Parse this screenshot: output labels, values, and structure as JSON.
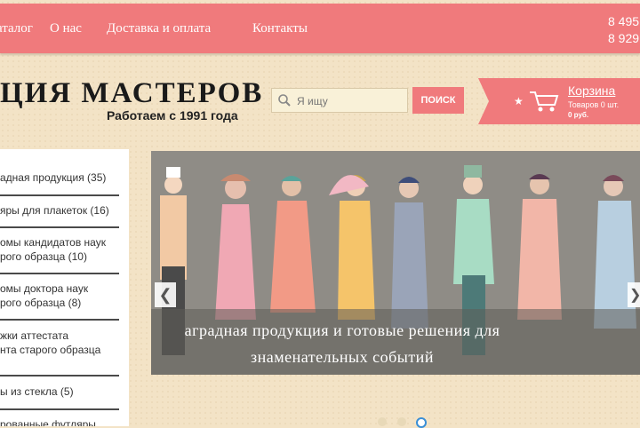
{
  "nav": {
    "items": [
      "аталог",
      "О нас",
      "Доставка и оплата",
      "Контакты"
    ],
    "phones": [
      "8 495",
      "8 929"
    ]
  },
  "logo": {
    "title": "ЦИЯ МАСТЕРОВ",
    "subtitle": "Работаем с 1991 года"
  },
  "search": {
    "placeholder": "Я ищу",
    "button": "ПОИСК"
  },
  "cart": {
    "title": "Корзина",
    "count": "Товаров 0 шт.",
    "sum": "0 руб."
  },
  "sidebar": {
    "categories": [
      [
        "адная продукция (35)"
      ],
      [
        "яры для плакеток (16)"
      ],
      [
        "омы кандидатов наук",
        "рого образца (10)"
      ],
      [
        "омы доктора наук",
        "рого образца (8)"
      ],
      [
        "жки аттестата",
        "нта старого образца"
      ],
      [
        "ы из стекла (5)"
      ],
      [
        "рованные футляры"
      ]
    ]
  },
  "slider": {
    "caption_line1": "аградная продукция и готовые решения для",
    "caption_line2": "знаменательных событий",
    "prev_icon": "chevron-left-icon",
    "next_icon": "chevron-right-icon"
  },
  "colors": {
    "accent": "#f07a7c",
    "background": "#f3e3c6"
  }
}
